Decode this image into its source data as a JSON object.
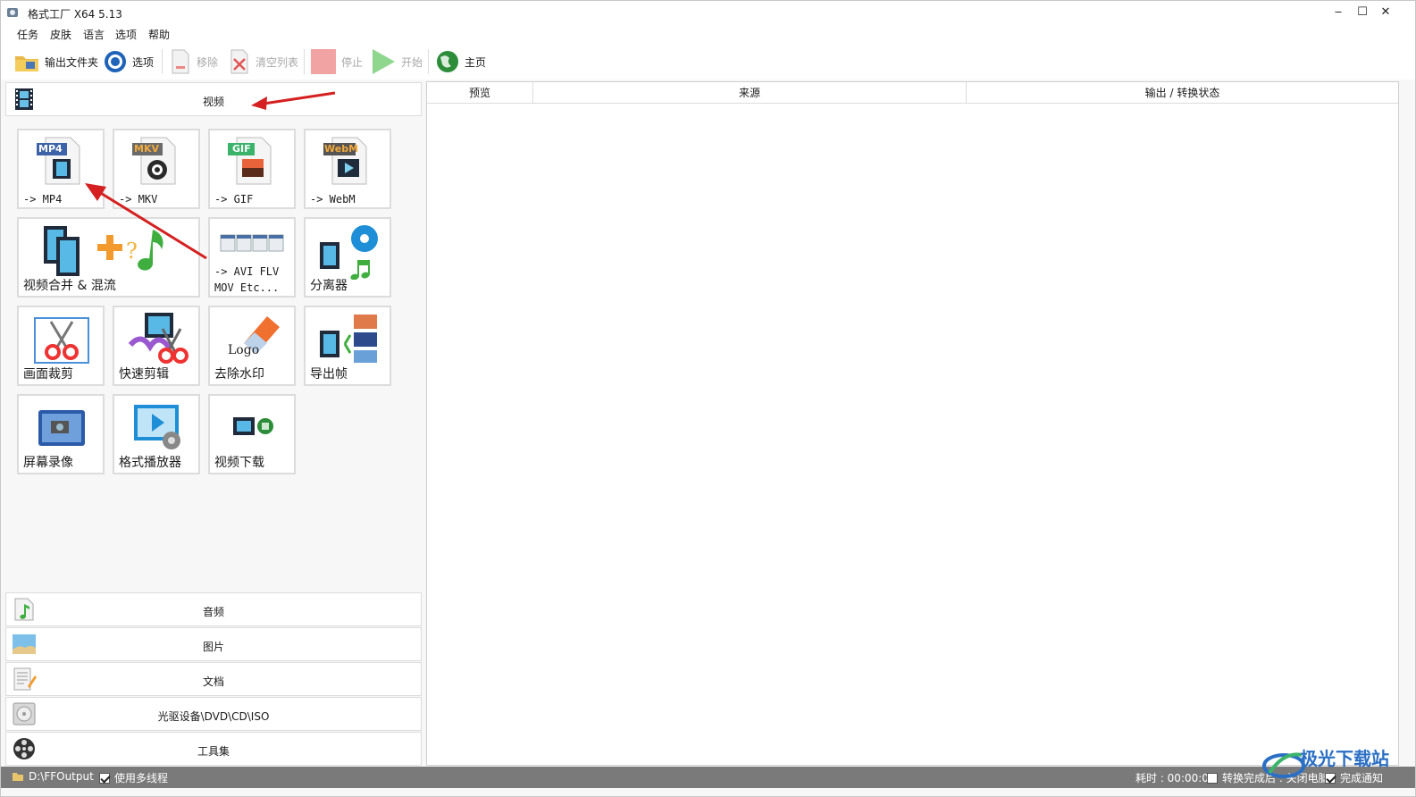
{
  "window": {
    "title": "格式工厂 X64 5.13",
    "minimize": "‒",
    "maximize": "☐",
    "close": "✕"
  },
  "menu": [
    "任务",
    "皮肤",
    "语言",
    "选项",
    "帮助"
  ],
  "toolbar": {
    "output_folder": "输出文件夹",
    "options": "选项",
    "remove": "移除",
    "clear_list": "清空列表",
    "stop": "停止",
    "start": "开始",
    "home": "主页"
  },
  "categories": {
    "video": "视频",
    "audio": "音频",
    "image": "图片",
    "document": "文档",
    "disc": "光驱设备\\DVD\\CD\\ISO",
    "tools": "工具集"
  },
  "video_tools": {
    "mp4": {
      "badge": "MP4",
      "label": "-> MP4"
    },
    "mkv": {
      "badge": "MKV",
      "label": "-> MKV"
    },
    "gif": {
      "badge": "GIF",
      "label": "-> GIF"
    },
    "webm": {
      "badge": "WebM",
      "label": "-> WebM"
    },
    "merge": {
      "label": "视频合并 & 混流"
    },
    "others": {
      "label_line1": "-> AVI FLV",
      "label_line2": "MOV Etc..."
    },
    "splitter": {
      "label": "分离器"
    },
    "crop": {
      "label": "画面裁剪"
    },
    "quick_cut": {
      "label": "快速剪辑"
    },
    "remove_watermark": {
      "label": "去除水印",
      "logo_text": "Logo"
    },
    "export_frames": {
      "label": "导出帧"
    },
    "screen_record": {
      "label": "屏幕录像"
    },
    "player": {
      "label": "格式播放器"
    },
    "download": {
      "label": "视频下载"
    }
  },
  "table": {
    "columns": [
      "预览",
      "来源",
      "输出 / 转换状态"
    ]
  },
  "status": {
    "output_path": "D:\\FFOutput",
    "multithread_label": "使用多线程",
    "multithread_checked": true,
    "elapsed": "耗时 : 00:00:00",
    "after_complete": "转换完成后 : 关闭电脑",
    "after_complete_checked": false,
    "notify": "完成通知",
    "notify_checked": true
  },
  "watermark": {
    "text": "极光下载站"
  },
  "colors": {
    "arrow": "#d42020",
    "status_bg": "#7a7a7a",
    "accent_blue": "#2b6fc4"
  }
}
